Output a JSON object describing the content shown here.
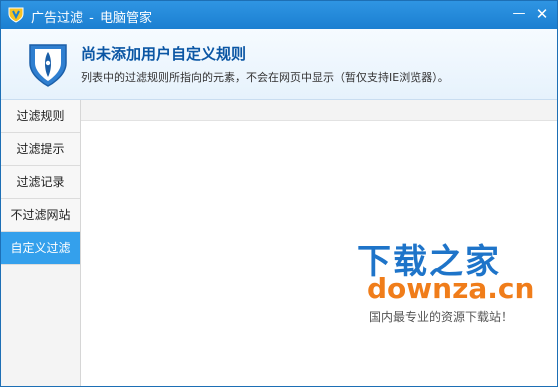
{
  "window": {
    "app_name": "广告过滤",
    "separator": "-",
    "product_name": "电脑管家",
    "minimize_glyph": "—",
    "close_glyph": "✕"
  },
  "header": {
    "title": "尚未添加用户自定义规则",
    "description": "列表中的过滤规则所指向的元素，不会在网页中显示（暂仅支持IE浏览器）。"
  },
  "sidebar": {
    "items": [
      {
        "label": "过滤规则"
      },
      {
        "label": "过滤提示"
      },
      {
        "label": "过滤记录"
      },
      {
        "label": "不过滤网站"
      },
      {
        "label": "自定义过滤",
        "selected": true
      }
    ]
  },
  "watermark": {
    "cn": "下载之家",
    "en": "downza.cn",
    "slogan": "国内最专业的资源下载站！"
  },
  "colors": {
    "titlebar": "#1b7fd1",
    "accent": "#34a0ec",
    "title_text": "#0b56a4"
  }
}
